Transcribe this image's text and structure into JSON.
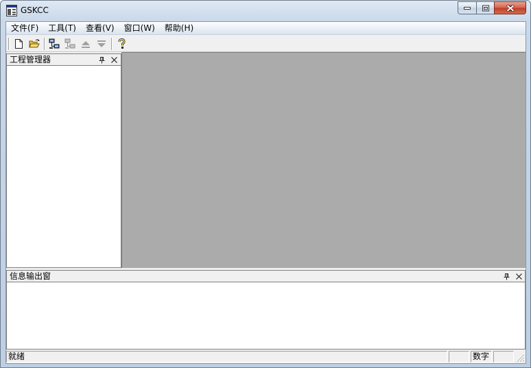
{
  "window": {
    "title": "GSKCC"
  },
  "menu": {
    "items": [
      "文件(F)",
      "工具(T)",
      "查看(V)",
      "窗口(W)",
      "帮助(H)"
    ]
  },
  "toolbar": {
    "buttons": [
      {
        "name": "new-file-icon",
        "enabled": true
      },
      {
        "name": "open-folder-icon",
        "enabled": true
      },
      {
        "name": "connect-icon",
        "enabled": true
      },
      {
        "name": "disconnect-icon",
        "enabled": false
      },
      {
        "name": "upload-icon",
        "enabled": false
      },
      {
        "name": "download-icon",
        "enabled": false
      },
      {
        "name": "help-icon",
        "enabled": true
      }
    ]
  },
  "project_panel": {
    "title": "工程管理器"
  },
  "output_panel": {
    "title": "信息输出窗"
  },
  "statusbar": {
    "status": "就绪",
    "num_indicator": "数字"
  },
  "colors": {
    "mdi_background": "#ababab",
    "close_button": "#c03d25"
  }
}
